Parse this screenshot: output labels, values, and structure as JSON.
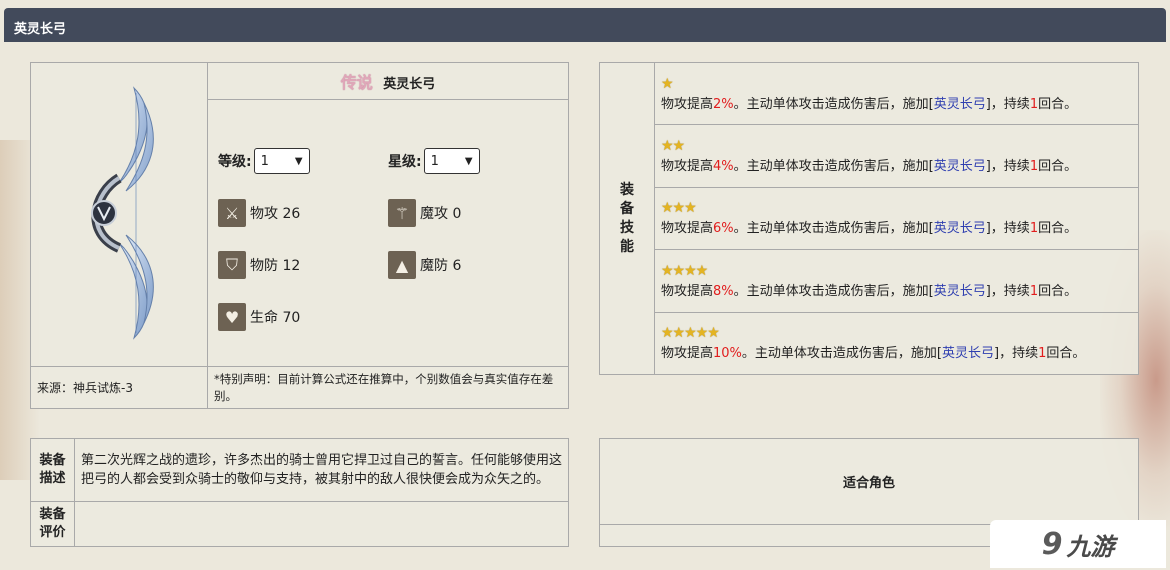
{
  "header": {
    "title": "英灵长弓"
  },
  "item": {
    "rarity": "传说",
    "name": "英灵长弓",
    "level_label": "等级:",
    "level_value": "1",
    "star_label": "星级:",
    "star_value": "1",
    "stats": [
      {
        "icon": "sword-icon",
        "label": "物攻 26"
      },
      {
        "icon": "magic-staff-icon",
        "label": "魔攻 0"
      },
      {
        "icon": "shield-icon",
        "label": "物防 12"
      },
      {
        "icon": "wizard-hat-icon",
        "label": "魔防 6"
      },
      {
        "icon": "heart-icon",
        "label": "生命 70"
      }
    ],
    "source": "来源：神兵试炼-3",
    "note": "*特别声明：目前计算公式还在推算中，个别数值会与真实值存在差别。"
  },
  "skills": {
    "header": "装备技能",
    "rows": [
      {
        "stars": "★",
        "p1": "物攻提高",
        "pct": "2%",
        "p2": "。主动单体攻击造成伤害后，施加[",
        "link": "英灵长弓",
        "p3": "]，持续",
        "turns": "1",
        "p4": "回合。"
      },
      {
        "stars": "★★",
        "p1": "物攻提高",
        "pct": "4%",
        "p2": "。主动单体攻击造成伤害后，施加[",
        "link": "英灵长弓",
        "p3": "]，持续",
        "turns": "1",
        "p4": "回合。"
      },
      {
        "stars": "★★★",
        "p1": "物攻提高",
        "pct": "6%",
        "p2": "。主动单体攻击造成伤害后，施加[",
        "link": "英灵长弓",
        "p3": "]，持续",
        "turns": "1",
        "p4": "回合。"
      },
      {
        "stars": "★★★★",
        "p1": "物攻提高",
        "pct": "8%",
        "p2": "。主动单体攻击造成伤害后，施加[",
        "link": "英灵长弓",
        "p3": "]，持续",
        "turns": "1",
        "p4": "回合。"
      },
      {
        "stars": "★★★★★",
        "p1": "物攻提高",
        "pct": "10%",
        "p2": "。主动单体攻击造成伤害后，施加[",
        "link": "英灵长弓",
        "p3": "]，持续",
        "turns": "1",
        "p4": "回合。"
      }
    ]
  },
  "description": {
    "desc_label": "装备描述",
    "desc_text": "第二次光辉之战的遗珍，许多杰出的骑士曾用它捍卫过自己的誓言。任何能够使用这把弓的人都会受到众骑士的敬仰与支持，被其射中的敌人很快便会成为众矢之的。",
    "eval_label": "装备评价",
    "eval_text": ""
  },
  "roles": {
    "title": "适合角色"
  },
  "logo": {
    "mark": "9",
    "text": "九游"
  }
}
